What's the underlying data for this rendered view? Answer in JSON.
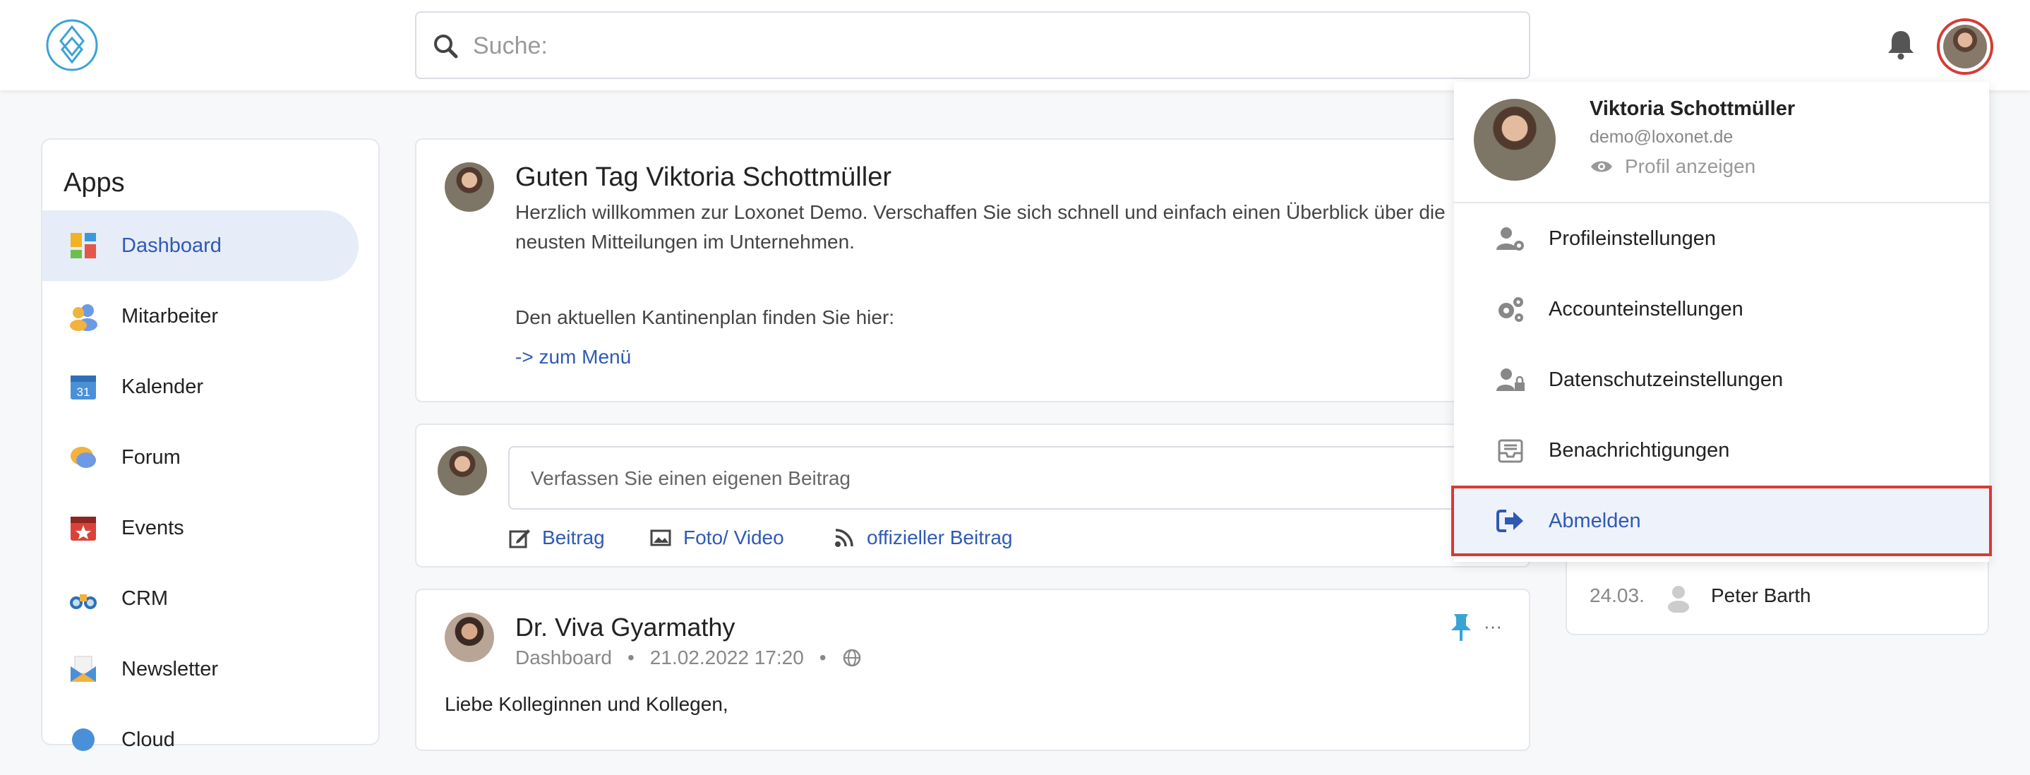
{
  "search": {
    "placeholder": "Suche:"
  },
  "sidebar": {
    "title": "Apps",
    "items": [
      {
        "label": "Dashboard"
      },
      {
        "label": "Mitarbeiter"
      },
      {
        "label": "Kalender",
        "icon_text": "31"
      },
      {
        "label": "Forum"
      },
      {
        "label": "Events"
      },
      {
        "label": "CRM"
      },
      {
        "label": "Newsletter"
      },
      {
        "label": "Cloud"
      }
    ]
  },
  "greeting": {
    "title": "Guten Tag Viktoria Schottmüller",
    "text": "Herzlich willkommen zur Loxonet Demo. Verschaffen Sie sich schnell und einfach einen Überblick über die neusten Mitteilungen im Unternehmen.",
    "canteen_text": "Den aktuellen Kantinenplan finden Sie hier:",
    "menu_link": "-> zum Menü"
  },
  "composer": {
    "placeholder": "Verfassen Sie einen eigenen Beitrag",
    "actions": [
      {
        "label": "Beitrag"
      },
      {
        "label": "Foto/ Video"
      },
      {
        "label": "offizieller Beitrag"
      }
    ]
  },
  "post": {
    "author": "Dr. Viva Gyarmathy",
    "app": "Dashboard",
    "date": "21.02.2022 17:20",
    "body": "Liebe Kolleginnen und Kollegen,"
  },
  "birthday": {
    "date": "24.03.",
    "name": "Peter Barth"
  },
  "user_menu": {
    "name": "Viktoria Schottmüller",
    "email": "demo@loxonet.de",
    "view_profile": "Profil anzeigen",
    "items": [
      {
        "label": "Profileinstellungen",
        "icon": "user-gear-icon"
      },
      {
        "label": "Accounteinstellungen",
        "icon": "gears-icon"
      },
      {
        "label": "Datenschutzeinstellungen",
        "icon": "user-lock-icon"
      },
      {
        "label": "Benachrichtigungen",
        "icon": "inbox-icon"
      },
      {
        "label": "Abmelden",
        "icon": "logout-icon"
      }
    ]
  },
  "colors": {
    "accent": "#2f5ab4",
    "highlight": "#d53b35",
    "active_bg": "#e6ecf8"
  }
}
